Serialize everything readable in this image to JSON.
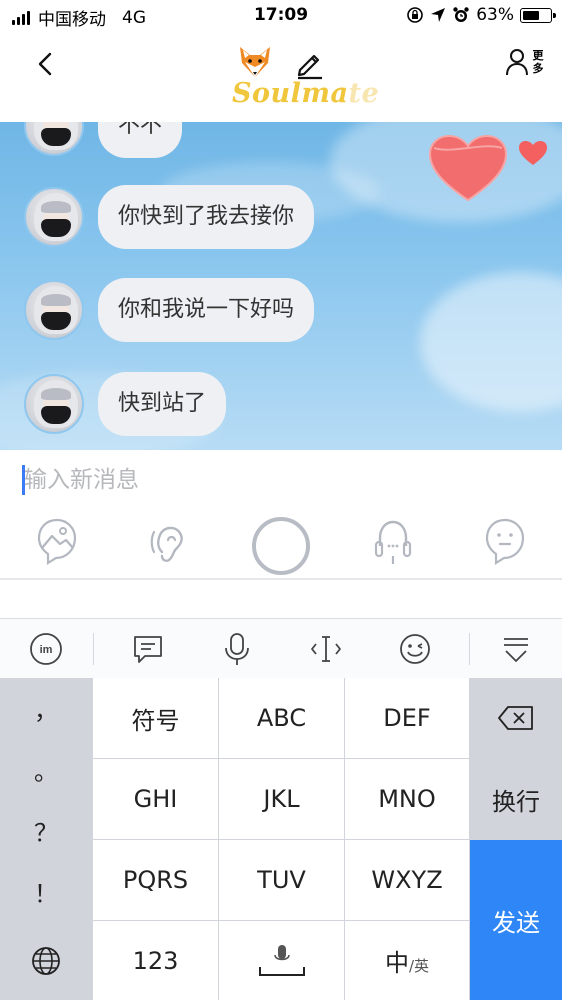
{
  "status_bar": {
    "carrier": "中国移动",
    "network": "4G",
    "time": "17:09",
    "battery_pct": "63%",
    "battery_level": 0.63,
    "icons": [
      "signal-bars-icon",
      "orientation-lock-icon",
      "location-arrow-icon",
      "alarm-icon",
      "battery-icon"
    ]
  },
  "header": {
    "back_icon": "chevron-left-icon",
    "brand_main": "Soulma",
    "brand_fade": "te",
    "fox_icon": "fox-face-icon",
    "edit_icon": "pencil-icon",
    "more_label": "更多",
    "more_icon": "person-icon"
  },
  "chat": {
    "messages": [
      {
        "text": "不不"
      },
      {
        "text": "你快到了我去接你"
      },
      {
        "text": "你和我说一下好吗"
      },
      {
        "text": "快到站了"
      }
    ],
    "heart_colors": {
      "big": "#f26d6d",
      "small": "#f45f5f"
    }
  },
  "input": {
    "placeholder": "输入新消息",
    "value": ""
  },
  "action_icons": [
    "image-icon",
    "ear-icon",
    "record-button",
    "headphone-icon",
    "face-icon"
  ],
  "keyboard": {
    "toolbar_icons": [
      "ime-icon",
      "message-icon",
      "microphone-icon",
      "cursor-icon",
      "emoji-icon",
      "collapse-keyboard-icon"
    ],
    "punct": [
      "，",
      "。",
      "？",
      "！"
    ],
    "keys": {
      "r1": [
        "符号",
        "ABC",
        "DEF"
      ],
      "r2": [
        "GHI",
        "JKL",
        "MNO"
      ],
      "r3": [
        "PQRS",
        "TUV",
        "WXYZ"
      ],
      "r4_123": "123",
      "r4_lang_main": "中",
      "r4_lang_sub": "/英"
    },
    "newline": "换行",
    "send": "发送",
    "accent": "#2f87f7"
  }
}
